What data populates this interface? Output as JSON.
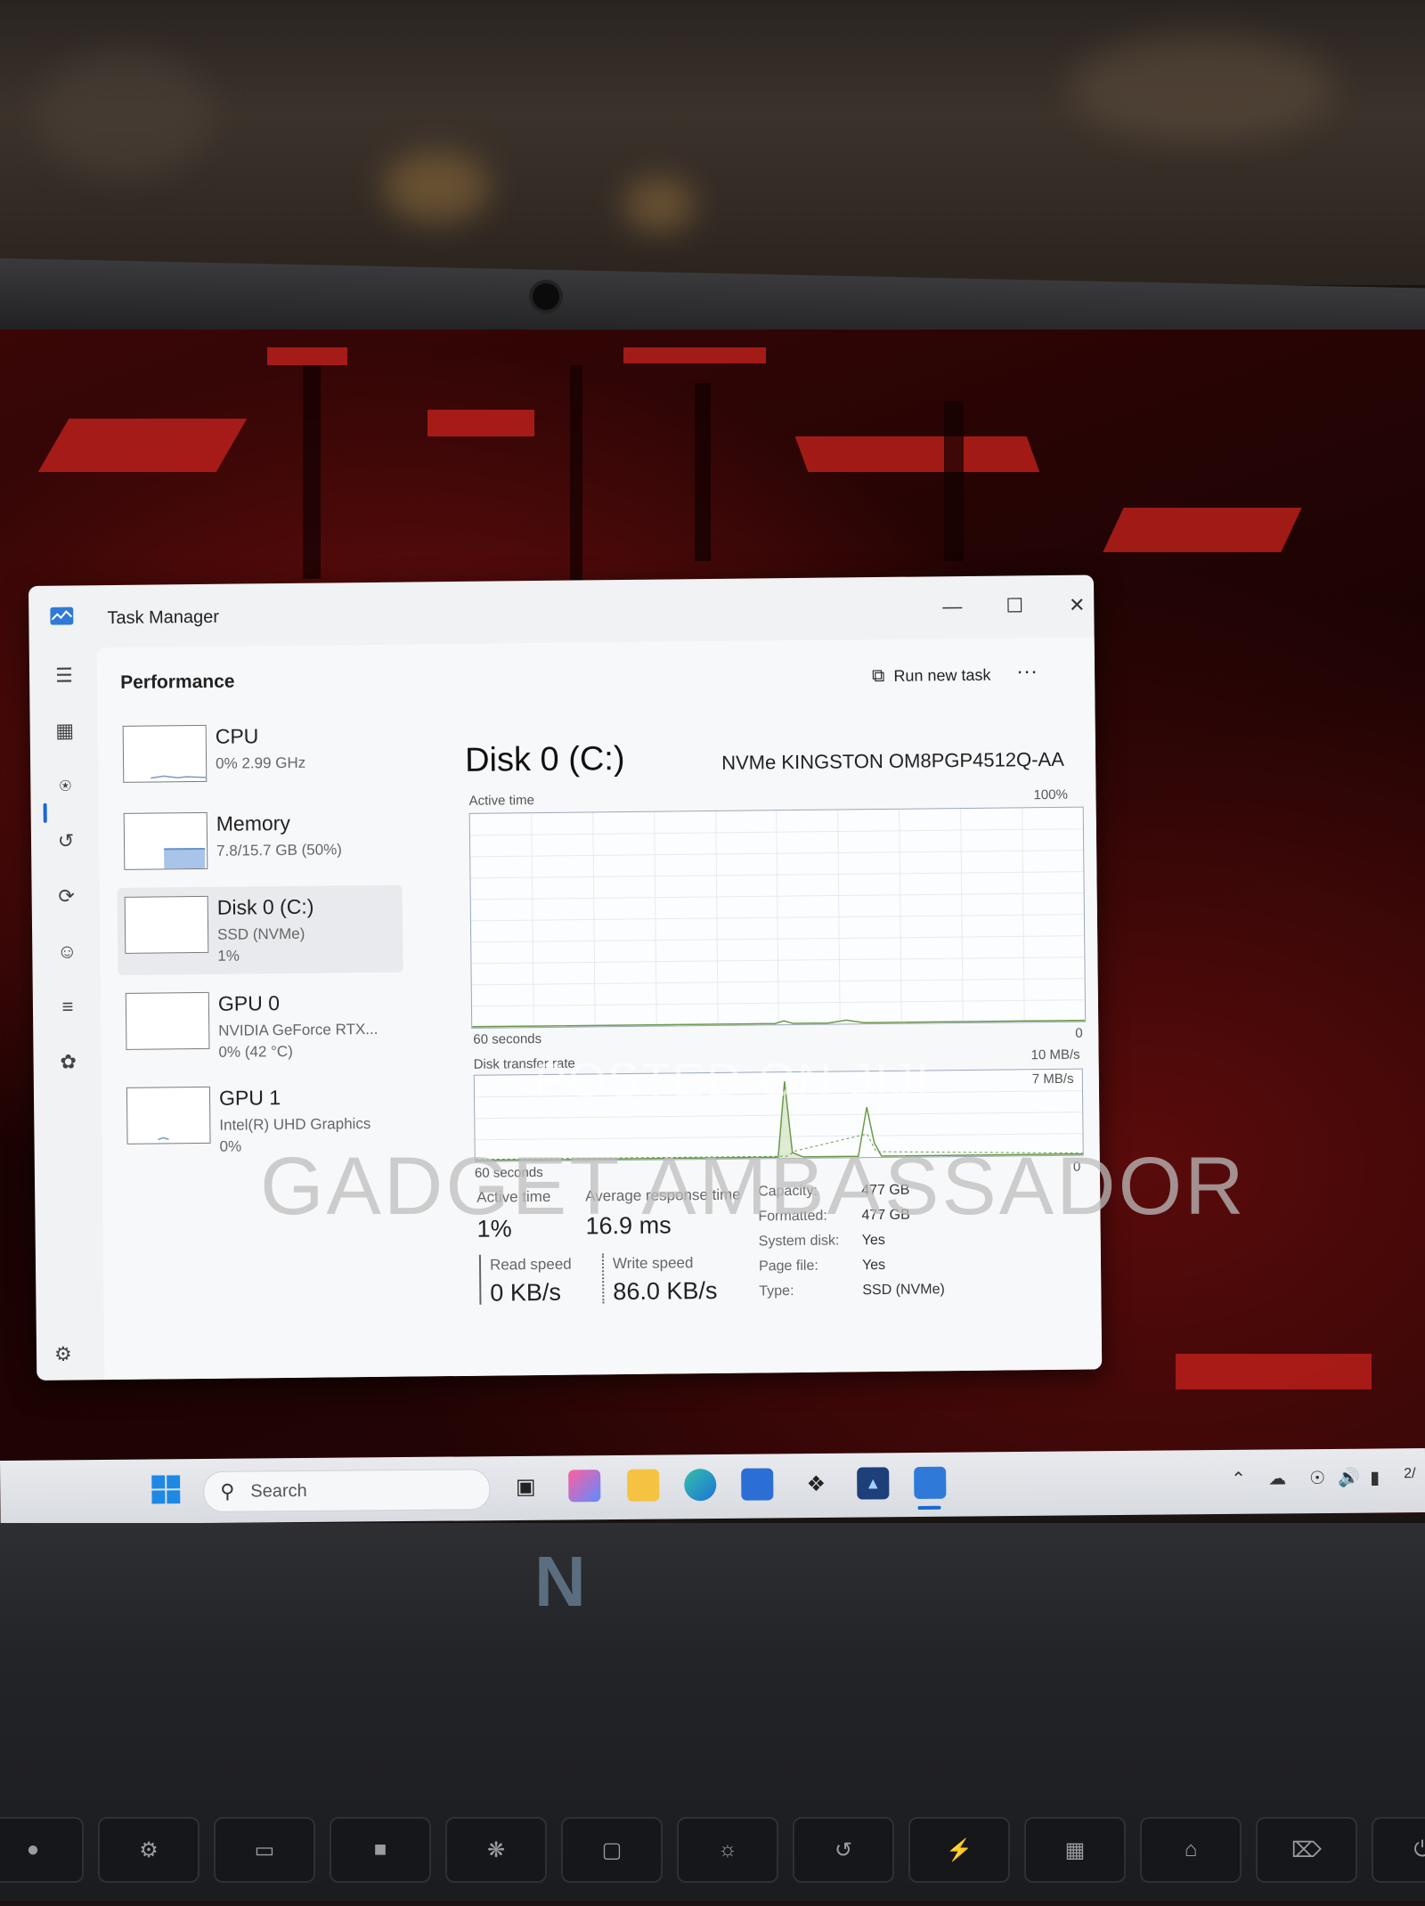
{
  "window": {
    "title": "Task Manager",
    "minimize_icon": "minimize-icon",
    "maximize_icon": "maximize-icon",
    "close_icon": "close-icon"
  },
  "toolbar": {
    "section_title": "Performance",
    "run_new_task_label": "Run new task",
    "more_label": "···"
  },
  "sidebar": {
    "items": [
      {
        "name": "CPU",
        "sub1": "0%  2.99 GHz",
        "sub2": ""
      },
      {
        "name": "Memory",
        "sub1": "7.8/15.7 GB (50%)",
        "sub2": ""
      },
      {
        "name": "Disk 0 (C:)",
        "sub1": "SSD (NVMe)",
        "sub2": "1%"
      },
      {
        "name": "GPU 0",
        "sub1": "NVIDIA GeForce RTX...",
        "sub2": "0%  (42 °C)"
      },
      {
        "name": "GPU 1",
        "sub1": "Intel(R) UHD Graphics",
        "sub2": "0%"
      }
    ],
    "memory_fill_percent": 50
  },
  "detail": {
    "title": "Disk 0 (C:)",
    "model": "NVMe KINGSTON OM8PGP4512Q-AA",
    "active_time_label": "Active time",
    "active_time_max": "100%",
    "graph1_x_left": "60 seconds",
    "graph1_x_right": "0",
    "transfer_label": "Disk transfer rate",
    "transfer_max": "10 MB/s",
    "transfer_mid": "7 MB/s",
    "graph2_x_left": "60 seconds",
    "graph2_x_right": "0",
    "stats": {
      "active_time_label": "Active time",
      "active_time_value": "1%",
      "avg_response_label": "Average response time",
      "avg_response_value": "16.9 ms",
      "read_label": "Read speed",
      "read_value": "0 KB/s",
      "write_label": "Write speed",
      "write_value": "86.0 KB/s"
    },
    "properties": [
      {
        "key": "Capacity:",
        "value": "477 GB"
      },
      {
        "key": "Formatted:",
        "value": "477 GB"
      },
      {
        "key": "System disk:",
        "value": "Yes"
      },
      {
        "key": "Page file:",
        "value": "Yes"
      },
      {
        "key": "Type:",
        "value": "SSD (NVMe)"
      }
    ]
  },
  "watermark": {
    "line1": "POSTED ON JIJI",
    "line2": "GADGET AMBASSADOR"
  },
  "taskbar": {
    "search_placeholder": "Search",
    "tray_time": "2/"
  },
  "colors": {
    "accent": "#1967d2",
    "graph_line": "#6b9a4a",
    "memory_fill": "#a8c4e8"
  }
}
